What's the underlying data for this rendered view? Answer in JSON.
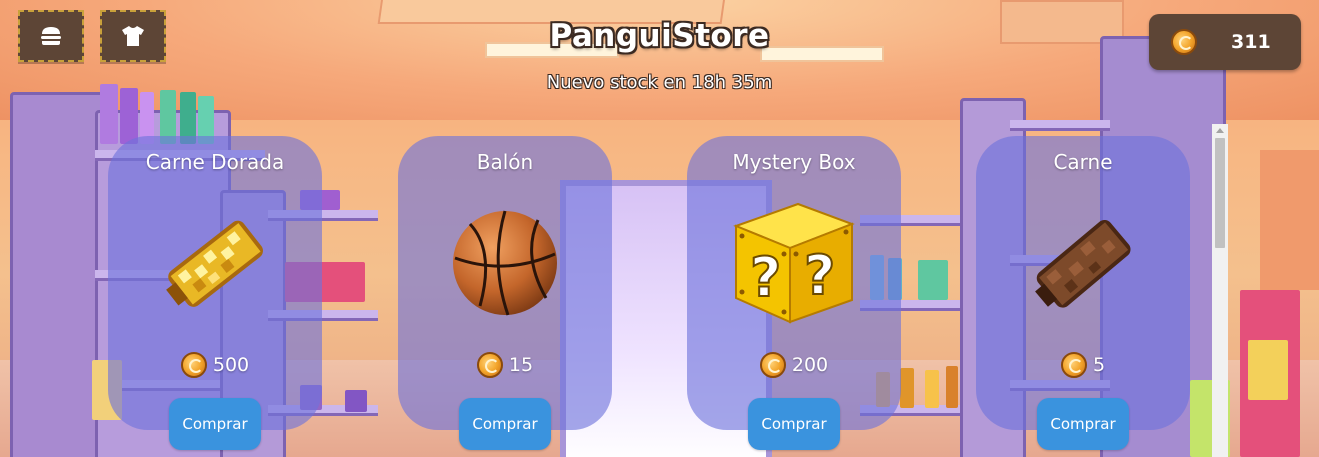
{
  "header": {
    "title": "PanguiStore",
    "subtitle": "Nuevo stock en 18h 35m",
    "food_button_icon": "burger-icon",
    "clothes_button_icon": "shirt-icon"
  },
  "wallet": {
    "icon": "coin-icon",
    "coins": "311"
  },
  "colors": {
    "card_bg": "#6e73dc",
    "buy_button": "#3a93de",
    "button_dark": "#5d4536",
    "button_border": "#c9a13a"
  },
  "items": [
    {
      "name": "Carne Dorada",
      "price": "500",
      "buy_label": "Comprar",
      "icon": "golden-meat-icon"
    },
    {
      "name": "Balón",
      "price": "15",
      "buy_label": "Comprar",
      "icon": "basketball-icon"
    },
    {
      "name": "Mystery Box",
      "price": "200",
      "buy_label": "Comprar",
      "icon": "mystery-box-icon"
    },
    {
      "name": "Carne",
      "price": "5",
      "buy_label": "Comprar",
      "icon": "meat-icon"
    }
  ]
}
